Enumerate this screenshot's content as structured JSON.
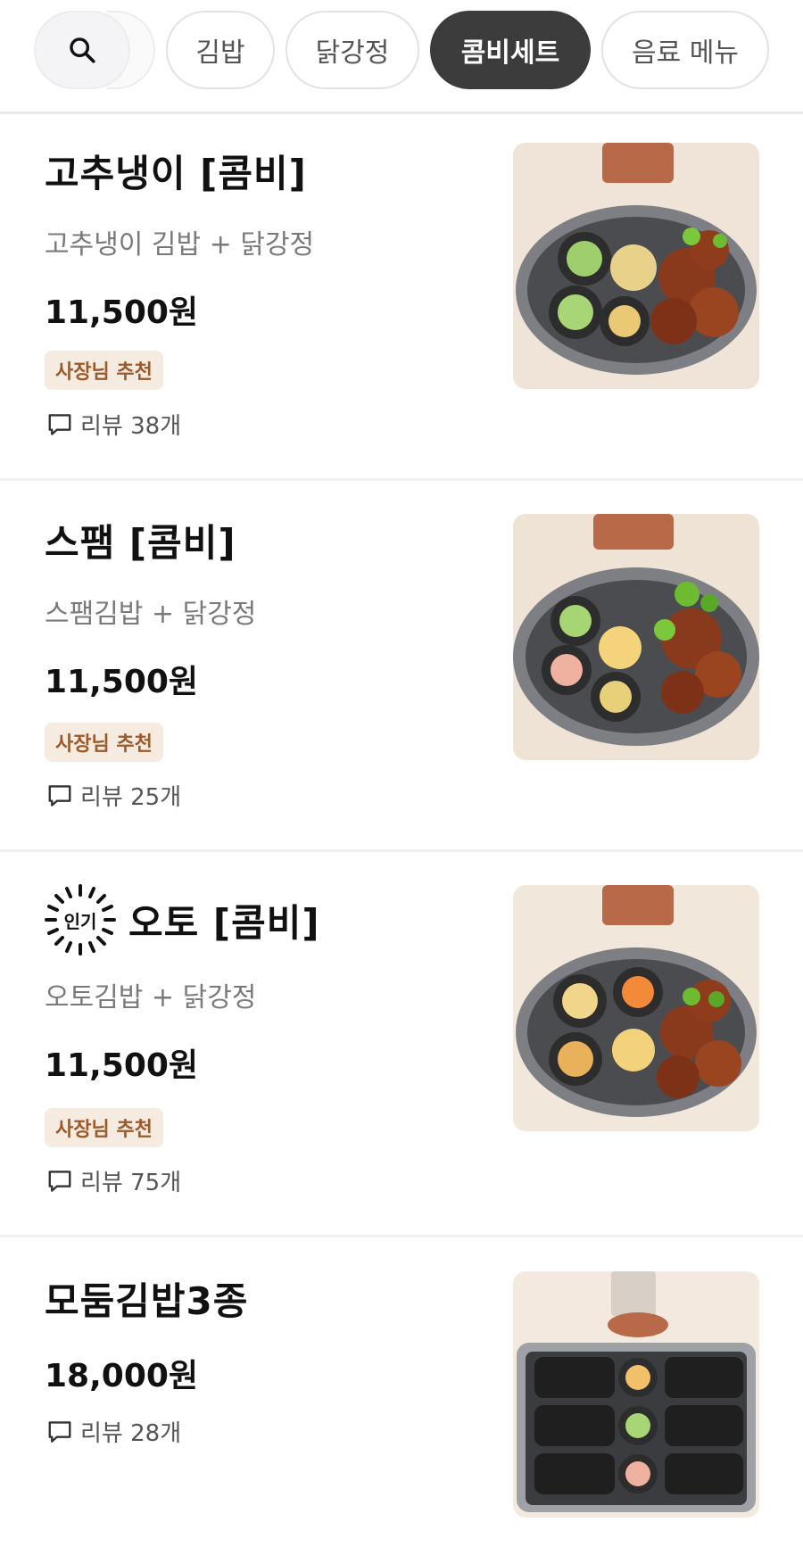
{
  "tabs": {
    "search_icon": "search-icon",
    "items": [
      {
        "label": "김밥",
        "active": false
      },
      {
        "label": "닭강정",
        "active": false
      },
      {
        "label": "콤비세트",
        "active": true
      },
      {
        "label": "음료 메뉴",
        "active": false
      }
    ]
  },
  "menu": [
    {
      "name": "고추냉이 [콤비]",
      "description": "고추냉이 김밥 + 닭강정",
      "price": "11,500원",
      "badge": "사장님 추천",
      "reviews": "리뷰 38개",
      "popular": false
    },
    {
      "name": "스팸 [콤비]",
      "description": "스팸김밥 + 닭강정",
      "price": "11,500원",
      "badge": "사장님 추천",
      "reviews": "리뷰 25개",
      "popular": false
    },
    {
      "name": "오토 [콤비]",
      "popular_label": "인기",
      "description": "오토김밥 + 닭강정",
      "price": "11,500원",
      "badge": "사장님 추천",
      "reviews": "리뷰 75개",
      "popular": true
    },
    {
      "name": "모둠김밥3종",
      "price": "18,000원",
      "reviews": "리뷰 28개",
      "popular": false
    }
  ],
  "colors": {
    "active_tab": "#3c3c3c",
    "badge_bg": "#f5ebe1",
    "badge_text": "#9a5a2a"
  }
}
